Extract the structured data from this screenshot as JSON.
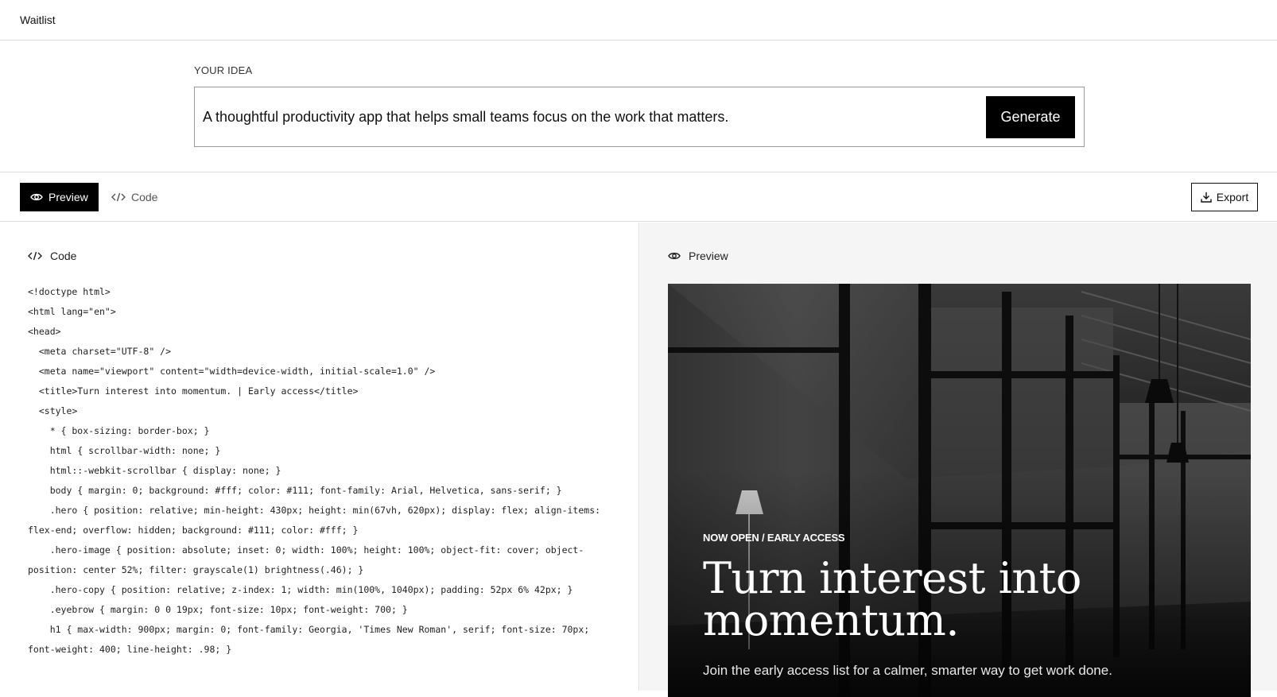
{
  "app": {
    "title": "Waitlist"
  },
  "idea": {
    "label": "YOUR IDEA",
    "value": "A thoughtful productivity app that helps small teams focus on the work that matters.",
    "generate_label": "Generate"
  },
  "tabs": [
    {
      "label": "Preview",
      "icon": "eye-icon",
      "active": true
    },
    {
      "label": "Code",
      "icon": "code-icon",
      "active": false
    }
  ],
  "export_label": "Export",
  "code_panel": {
    "title": "Code",
    "lines": [
      "<!doctype html>",
      "<html lang=\"en\">",
      "<head>",
      "  <meta charset=\"UTF-8\" />",
      "  <meta name=\"viewport\" content=\"width=device-width, initial-scale=1.0\" />",
      "  <title>Turn interest into momentum. | Early access</title>",
      "  <style>",
      "    * { box-sizing: border-box; }",
      "    html { scrollbar-width: none; }",
      "    html::-webkit-scrollbar { display: none; }",
      "    body { margin: 0; background: #fff; color: #111; font-family: Arial, Helvetica, sans-serif; }",
      "    .hero { position: relative; min-height: 430px; height: min(67vh, 620px); display: flex; align-items:",
      "flex-end; overflow: hidden; background: #111; color: #fff; }",
      "    .hero-image { position: absolute; inset: 0; width: 100%; height: 100%; object-fit: cover; object-",
      "position: center 52%; filter: grayscale(1) brightness(.46); }",
      "    .hero-copy { position: relative; z-index: 1; width: min(100%, 1040px); padding: 52px 6% 42px; }",
      "    .eyebrow { margin: 0 0 19px; font-size: 10px; font-weight: 700; }",
      "    h1 { max-width: 900px; margin: 0; font-family: Georgia, 'Times New Roman', serif; font-size: 70px;",
      "font-weight: 400; line-height: .98; }"
    ]
  },
  "preview_panel": {
    "title": "Preview",
    "eyebrow": "NOW OPEN / EARLY ACCESS",
    "heading_line1": "Turn interest into",
    "heading_line2": "momentum.",
    "subheading": "Join the early access list for a calmer, smarter way to get work done."
  },
  "colors": {
    "accent": "#000000",
    "border": "#dcdcdc",
    "preview_bg": "#f5f5f5"
  }
}
